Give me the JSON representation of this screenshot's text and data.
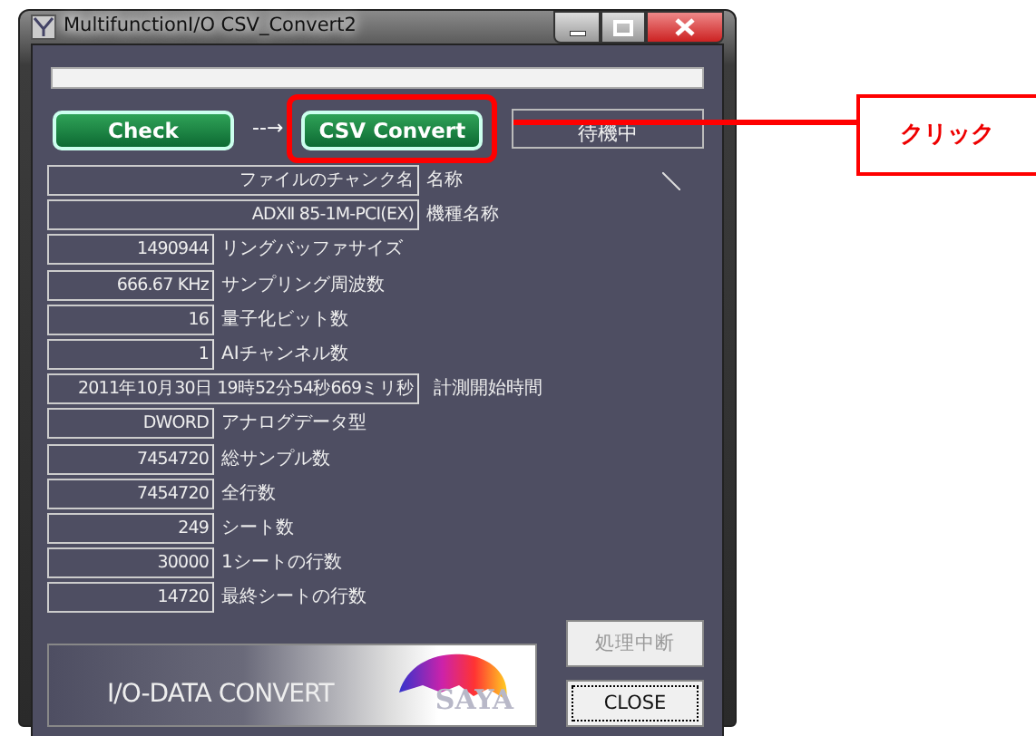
{
  "window": {
    "title": "MultifunctionI/O CSV_Convert2"
  },
  "actions": [
    {
      "kind": "button",
      "label": "Check",
      "highlighted": false
    },
    {
      "kind": "arrow",
      "label": "--→"
    },
    {
      "kind": "button",
      "label": "CSV Convert",
      "highlighted": true
    },
    {
      "kind": "status",
      "label": "待機中"
    }
  ],
  "fields": [
    {
      "kind": "wide",
      "value": "ファイルのチャンク名",
      "label": "名称"
    },
    {
      "kind": "wide",
      "value": "ADXⅡ 85-1M-PCI(EX)",
      "label": "機種名称"
    },
    {
      "kind": "narrow",
      "value": "1490944",
      "label": "リングバッファサイズ"
    },
    {
      "kind": "narrow",
      "value": "666.67 KHz",
      "label": "サンプリング周波数"
    },
    {
      "kind": "narrow",
      "value": "16",
      "label": "量子化ビット数"
    },
    {
      "kind": "narrow",
      "value": "1",
      "label": "AIチャンネル数"
    },
    {
      "kind": "wide",
      "value": "2011年10月30日 19時52分54秒669ミリ秒",
      "label": "計測開始時間"
    },
    {
      "kind": "narrow",
      "value": "DWORD",
      "label": "アナログデータ型"
    },
    {
      "kind": "narrow",
      "value": "7454720",
      "label": "総サンプル数"
    },
    {
      "kind": "narrow",
      "value": "7454720",
      "label": "全行数"
    },
    {
      "kind": "narrow",
      "value": "249",
      "label": "シート数"
    },
    {
      "kind": "narrow",
      "value": "30000",
      "label": "1シートの行数"
    },
    {
      "kind": "narrow",
      "value": "14720",
      "label": "最終シートの行数"
    }
  ],
  "banner": {
    "text": "I/O-DATA CONVERT",
    "logo_text": "SAYA"
  },
  "buttons": [
    {
      "label": "処理中断",
      "disabled": true
    },
    {
      "label": "CLOSE",
      "disabled": false
    }
  ],
  "callout": {
    "text": "クリック"
  }
}
